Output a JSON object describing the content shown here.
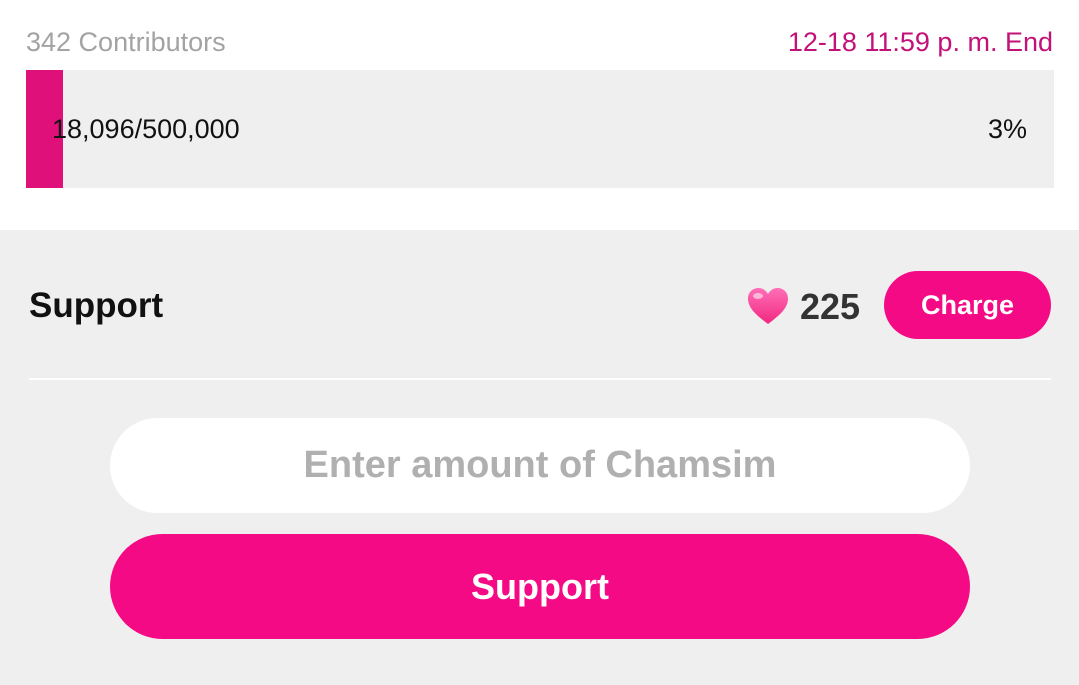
{
  "campaign": {
    "contributors_label": "342 Contributors",
    "end_label": "12-18 11:59 p. m. End",
    "progress_amount": "18,096/500,000",
    "progress_percent_label": "3%",
    "progress_fraction": 0.036
  },
  "support": {
    "title": "Support",
    "heart_icon": "heart-icon",
    "balance": "225",
    "charge_label": "Charge",
    "amount_placeholder": "Enter amount of Chamsim",
    "amount_value": "",
    "submit_label": "Support"
  },
  "colors": {
    "accent": "#f50a85",
    "progress_fill": "#e0107a",
    "end_time_text": "#c2127a",
    "panel_bg": "#efefef"
  }
}
